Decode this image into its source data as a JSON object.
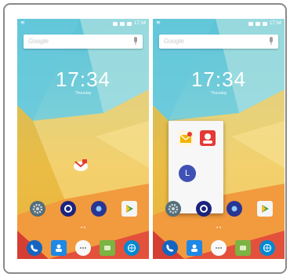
{
  "left_screen": {
    "status_bar": {
      "left_glyph": "≋",
      "time": "17:34"
    },
    "search": {
      "placeholder": "Google"
    },
    "clock": "17:34",
    "date": "Thursday",
    "home_row_icons": [
      "settings-icon",
      "camera-icon",
      "photos-icon",
      "play-store-icon"
    ],
    "dock_icons": [
      "phone-icon",
      "contacts-icon",
      "app-drawer-icon",
      "messages-icon",
      "browser-icon"
    ]
  },
  "right_screen": {
    "status_bar": {
      "left_glyph": "≋",
      "time": "17:34"
    },
    "search": {
      "placeholder": "Google"
    },
    "clock": "17:34",
    "date": "Thursday",
    "popup": {
      "apps": [
        {
          "icon": "mail-icon"
        },
        {
          "icon": "user-icon"
        },
        {
          "icon": "letter-l-icon",
          "letter": "L"
        }
      ]
    },
    "home_row_icons": [
      "settings-icon",
      "camera-icon",
      "photos-icon",
      "play-store-icon"
    ],
    "dock_icons": [
      "phone-icon",
      "contacts-icon",
      "app-drawer-icon",
      "messages-icon",
      "browser-icon"
    ]
  },
  "colors": {
    "frame_border": "#8a8a8a",
    "sky": "#5bc3d8",
    "yellow": "#f2c45a",
    "orange": "#f09a38",
    "red": "#e0543a",
    "popup_accent": "#3f51b5"
  }
}
